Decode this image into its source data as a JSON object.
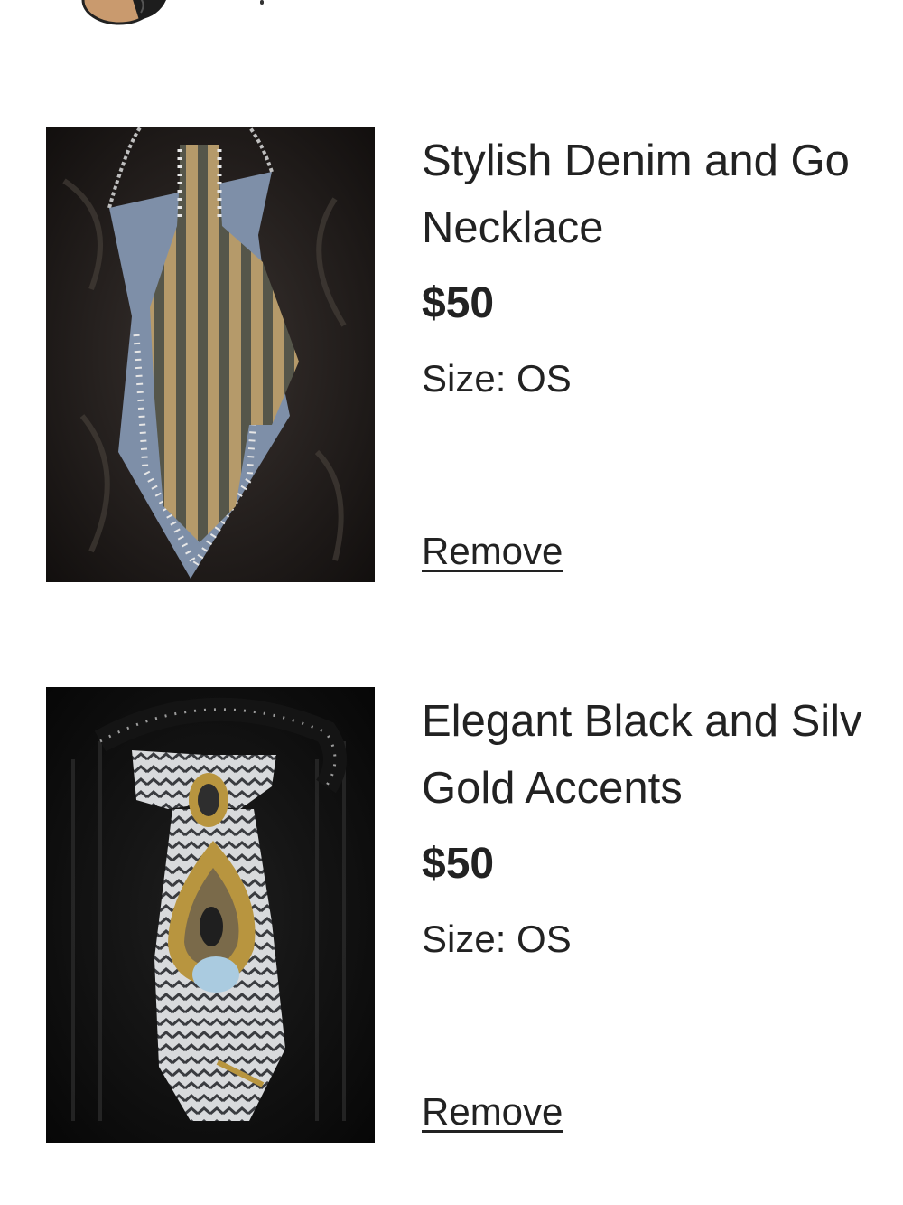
{
  "items": [
    {
      "title_line1": "Stylish Denim and Go",
      "title_line2": "Necklace",
      "price": "$50",
      "size": "Size: OS",
      "remove_label": "Remove",
      "image_icon": "denim-striped-tie-necklace-photo"
    },
    {
      "title_line1": "Elegant Black and Silv",
      "title_line2": "Gold Accents",
      "price": "$50",
      "size": "Size: OS",
      "remove_label": "Remove",
      "image_icon": "black-silver-tie-necklace-photo"
    }
  ],
  "colors": {
    "text": "#222222",
    "background": "#ffffff"
  }
}
